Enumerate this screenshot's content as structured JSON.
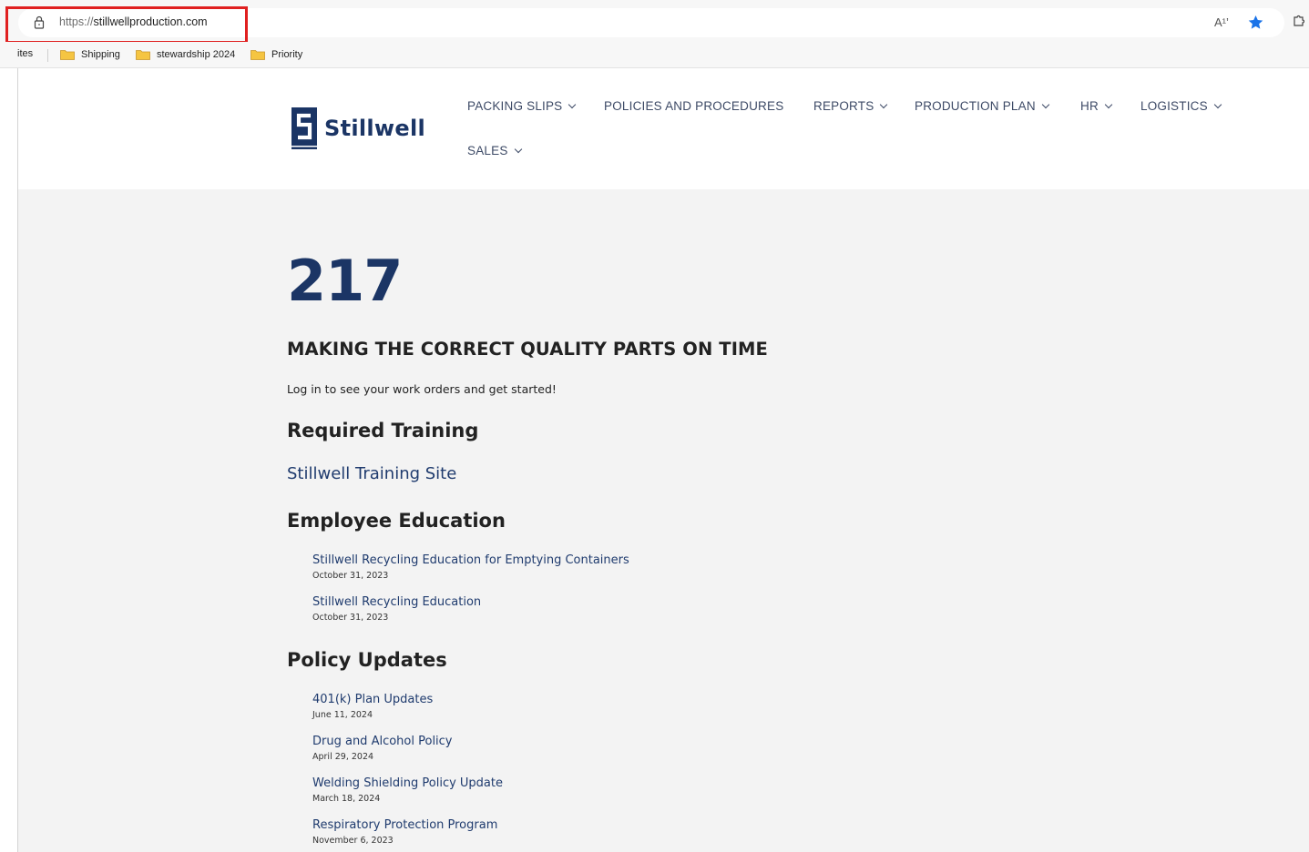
{
  "browser": {
    "url_scheme": "https://",
    "url_host": "stillwellproduction.com",
    "readaloud_label": "A¹’"
  },
  "bookmarks": {
    "cut_label": "ites",
    "items": [
      {
        "label": "Shipping"
      },
      {
        "label": "stewardship 2024"
      },
      {
        "label": "Priority"
      }
    ]
  },
  "site": {
    "logo_text": "Stillwell",
    "nav": [
      {
        "label": "PACKING SLIPS",
        "has_dropdown": true
      },
      {
        "label": "POLICIES AND PROCEDURES",
        "has_dropdown": false
      },
      {
        "label": "REPORTS",
        "has_dropdown": true
      },
      {
        "label": "PRODUCTION PLAN",
        "has_dropdown": true
      },
      {
        "label": "HR",
        "has_dropdown": true
      },
      {
        "label": "LOGISTICS",
        "has_dropdown": true
      },
      {
        "label": "SALES",
        "has_dropdown": true
      }
    ]
  },
  "main": {
    "big_number": "217",
    "tagline": "MAKING THE CORRECT QUALITY PARTS ON TIME",
    "login_text": "Log in to see your work orders and get started!",
    "required_training": {
      "heading": "Required Training",
      "link": "Stillwell Training Site"
    },
    "employee_education": {
      "heading": "Employee Education",
      "posts": [
        {
          "title": "Stillwell Recycling Education for Emptying Containers",
          "date": "October 31, 2023"
        },
        {
          "title": "Stillwell Recycling Education",
          "date": "October 31, 2023"
        }
      ]
    },
    "policy_updates": {
      "heading": "Policy Updates",
      "posts": [
        {
          "title": "401(k) Plan Updates",
          "date": "June 11, 2024"
        },
        {
          "title": "Drug and Alcohol Policy",
          "date": "April 29, 2024"
        },
        {
          "title": "Welding Shielding Policy Update",
          "date": "March 18, 2024"
        },
        {
          "title": "Respiratory Protection Program",
          "date": "November 6, 2023"
        }
      ]
    }
  },
  "colors": {
    "brand_navy": "#1b3565",
    "link_blue": "#1f3b6e",
    "highlight_red": "#e02020",
    "star_blue": "#1a73e8"
  }
}
